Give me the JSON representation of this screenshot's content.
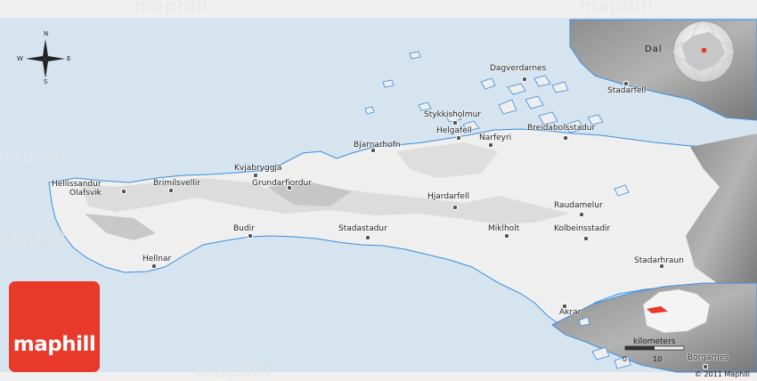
{
  "map": {
    "colors": {
      "water": "#d5e4ef",
      "land": "#efefef",
      "coast": "#3b8ee0",
      "relief": "#9a9a9a",
      "logo": "#e8392a"
    },
    "places": [
      {
        "id": "hellissandur",
        "label": "Hellissandur"
      },
      {
        "id": "olafsvik",
        "label": "Olafsvik"
      },
      {
        "id": "brimilsvellir",
        "label": "Brimilsvellir"
      },
      {
        "id": "kvjabryggja",
        "label": "Kvjabryggja"
      },
      {
        "id": "grundarfjordur",
        "label": "Grundarfjordur"
      },
      {
        "id": "bjarnarhofn",
        "label": "Bjarnarhofn"
      },
      {
        "id": "stykkisholmur",
        "label": "Stykkisholmur"
      },
      {
        "id": "helgafell",
        "label": "Helgafell"
      },
      {
        "id": "narfeyri",
        "label": "Narfeyri"
      },
      {
        "id": "breidabolsstadur",
        "label": "Breidabolsstadur"
      },
      {
        "id": "dagverdarnes",
        "label": "Dagverdarnes"
      },
      {
        "id": "stadarfell",
        "label": "Stadarfell"
      },
      {
        "id": "hjardarfell",
        "label": "Hjardarfell"
      },
      {
        "id": "raudamelur",
        "label": "Raudamelur"
      },
      {
        "id": "budir",
        "label": "Budir"
      },
      {
        "id": "stadastadur",
        "label": "Stadastadur"
      },
      {
        "id": "miklholt",
        "label": "Miklholt"
      },
      {
        "id": "kolbeinsstadir",
        "label": "Kolbeinsstadir"
      },
      {
        "id": "hellnar",
        "label": "Hellnar"
      },
      {
        "id": "stadarhraun",
        "label": "Stadarhraun"
      },
      {
        "id": "akrar",
        "label": "Akrar"
      },
      {
        "id": "borgarnes",
        "label": "Borgarnes"
      }
    ],
    "region_label": "Dal",
    "compass": {
      "n": "N",
      "s": "S",
      "e": "E",
      "w": "W"
    },
    "scale": {
      "title": "kilometers",
      "zero": "0",
      "ten": "10"
    },
    "copyright": "© 2011 Maphill",
    "logo_text": "maphill",
    "watermark": "maphill"
  }
}
